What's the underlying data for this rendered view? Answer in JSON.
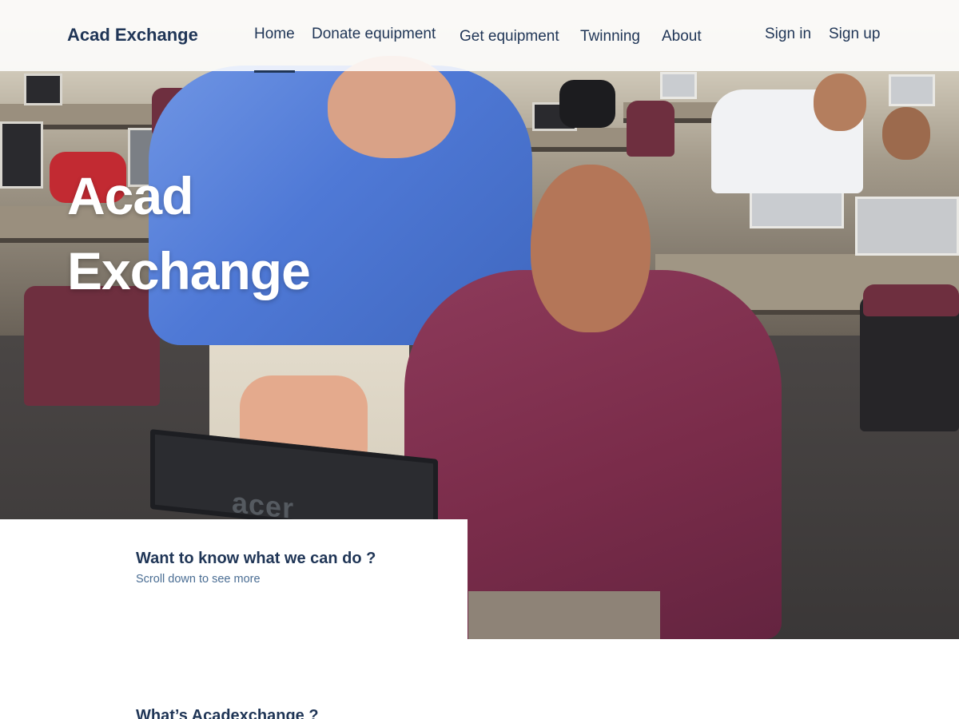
{
  "nav": {
    "brand": "Acad Exchange",
    "links": [
      {
        "label": "Home",
        "active": true
      },
      {
        "label": "Donate equipment",
        "active": false
      },
      {
        "label": "Get equipment",
        "active": false
      },
      {
        "label": "Twinning",
        "active": false
      },
      {
        "label": "About",
        "active": false
      }
    ],
    "auth": [
      {
        "label": "Sign in"
      },
      {
        "label": "Sign up"
      }
    ]
  },
  "hero": {
    "title_line1": "Acad",
    "title_line2": "Exchange",
    "photo_text": "acer"
  },
  "intro": {
    "heading": "Want to know what we can do ?",
    "subtext": "Scroll down to see more"
  },
  "about_section": {
    "heading": "What’s Acadexchange ?"
  },
  "colors": {
    "primary_text": "#1f3556",
    "secondary_text": "#4a6d93",
    "hero_title": "#ffffff",
    "nav_background": "#ffffff"
  }
}
